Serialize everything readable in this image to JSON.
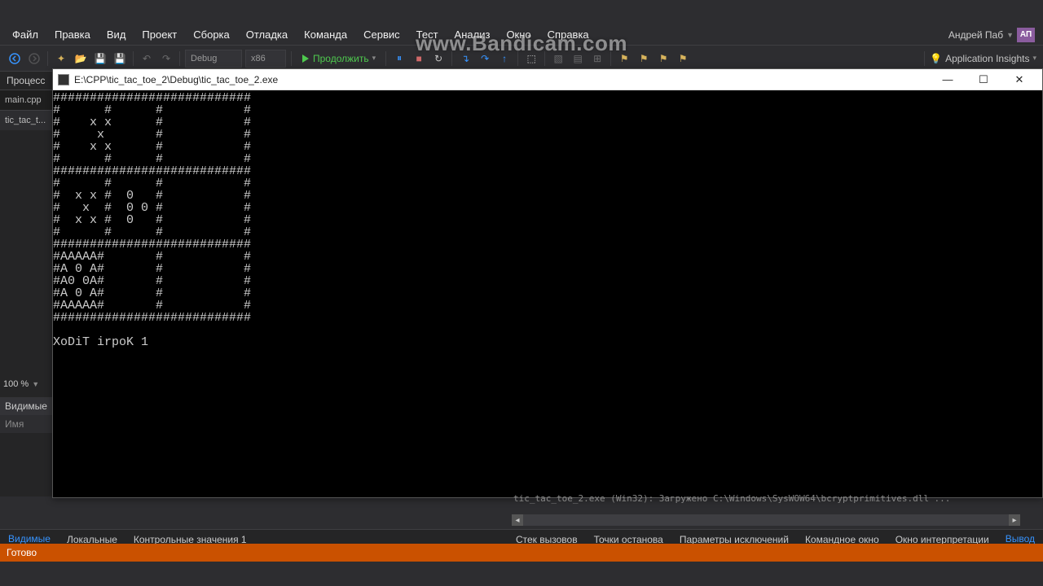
{
  "menubar": {
    "items": [
      "Файл",
      "Правка",
      "Вид",
      "Проект",
      "Сборка",
      "Отладка",
      "Команда",
      "Сервис",
      "Тест",
      "Анализ",
      "Окно",
      "Справка"
    ],
    "user_name": "Андрей Паб",
    "user_initials": "АП"
  },
  "toolbar": {
    "config_combo": "Debug",
    "platform_combo": "x86",
    "continue_label": "Продолжить",
    "app_insights": "Application Insights"
  },
  "process_label": "Процесс",
  "editor_tabs": {
    "main": "main.cpp",
    "second": "tic_tac_t..."
  },
  "zoom": "100 %",
  "locals_panel": {
    "header": "Видимые",
    "name_col": "Имя"
  },
  "console": {
    "title": "E:\\CPP\\tic_tac_toe_2\\Debug\\tic_tac_toe_2.exe",
    "lines": [
      "###########################",
      "#      #      #           #",
      "#    x x      #           #",
      "#     x       #           #",
      "#    x x      #           #",
      "#      #      #           #",
      "###########################",
      "#      #      #           #",
      "#  x x #  0   #           #",
      "#   x  #  0 0 #           #",
      "#  x x #  0   #           #",
      "#      #      #           #",
      "###########################",
      "#AAAAA#       #           #",
      "#A 0 A#       #           #",
      "#A0 0A#       #           #",
      "#A 0 A#       #           #",
      "#AAAAA#       #           #",
      "###########################",
      "",
      "XoDiT irpoK 1"
    ]
  },
  "output_tail": "tic_tac_toe_2.exe  (Win32): Загружено  C:\\Windows\\SysWOW64\\bcryptprimitives.dll  ...",
  "bottom_tabs": {
    "left": [
      {
        "label": "Видимые",
        "active": true
      },
      {
        "label": "Локальные",
        "active": false
      },
      {
        "label": "Контрольные значения 1",
        "active": false
      }
    ],
    "right": [
      {
        "label": "Стек вызовов",
        "active": false
      },
      {
        "label": "Точки останова",
        "active": false
      },
      {
        "label": "Параметры исключений",
        "active": false
      },
      {
        "label": "Командное окно",
        "active": false
      },
      {
        "label": "Окно интерпретации",
        "active": false
      },
      {
        "label": "Вывод",
        "active": true
      }
    ]
  },
  "statusbar": {
    "ready": "Готово"
  },
  "watermark": "www.Bandicam.com"
}
